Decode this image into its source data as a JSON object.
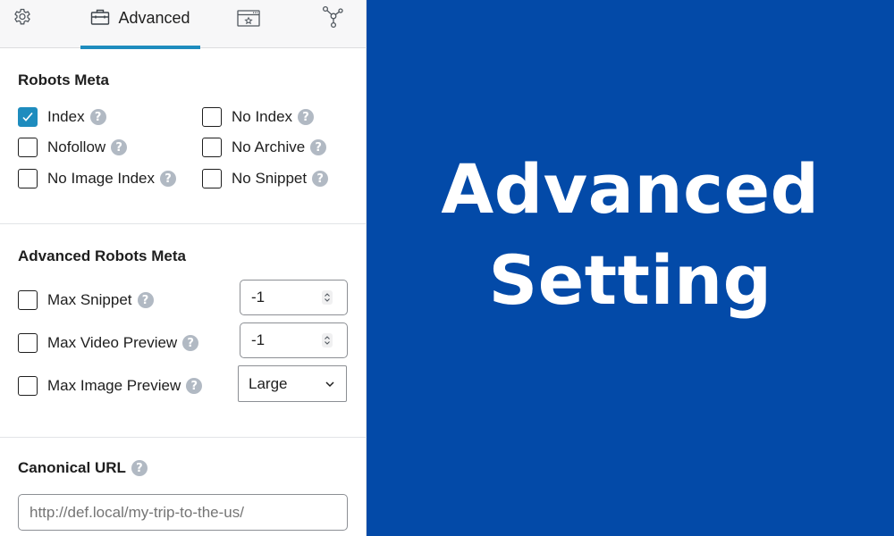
{
  "tabs": [
    {
      "name": "general",
      "icon": "gear-icon",
      "label": ""
    },
    {
      "name": "advanced",
      "icon": "toolbox-icon",
      "label": "Advanced",
      "active": true
    },
    {
      "name": "social",
      "icon": "browser-star-icon",
      "label": ""
    },
    {
      "name": "schema",
      "icon": "network-nodes-icon",
      "label": ""
    }
  ],
  "robots_meta": {
    "title": "Robots Meta",
    "options": [
      {
        "label": "Index",
        "checked": true
      },
      {
        "label": "No Index",
        "checked": false
      },
      {
        "label": "Nofollow",
        "checked": false
      },
      {
        "label": "No Archive",
        "checked": false
      },
      {
        "label": "No Image Index",
        "checked": false
      },
      {
        "label": "No Snippet",
        "checked": false
      }
    ]
  },
  "advanced_robots_meta": {
    "title": "Advanced Robots Meta",
    "max_snippet": {
      "label": "Max Snippet",
      "checked": false,
      "value": "-1"
    },
    "max_video_preview": {
      "label": "Max Video Preview",
      "checked": false,
      "value": "-1"
    },
    "max_image_preview": {
      "label": "Max Image Preview",
      "checked": false,
      "value": "Large"
    }
  },
  "canonical": {
    "title": "Canonical URL",
    "placeholder": "http://def.local/my-trip-to-the-us/",
    "value": ""
  },
  "help_glyph": "?",
  "hero": {
    "line1": "Advanced",
    "line2": "Setting"
  },
  "colors": {
    "accent": "#1e8cbe",
    "hero_bg": "#034aa8",
    "help_icon": "#b1b9c3"
  }
}
